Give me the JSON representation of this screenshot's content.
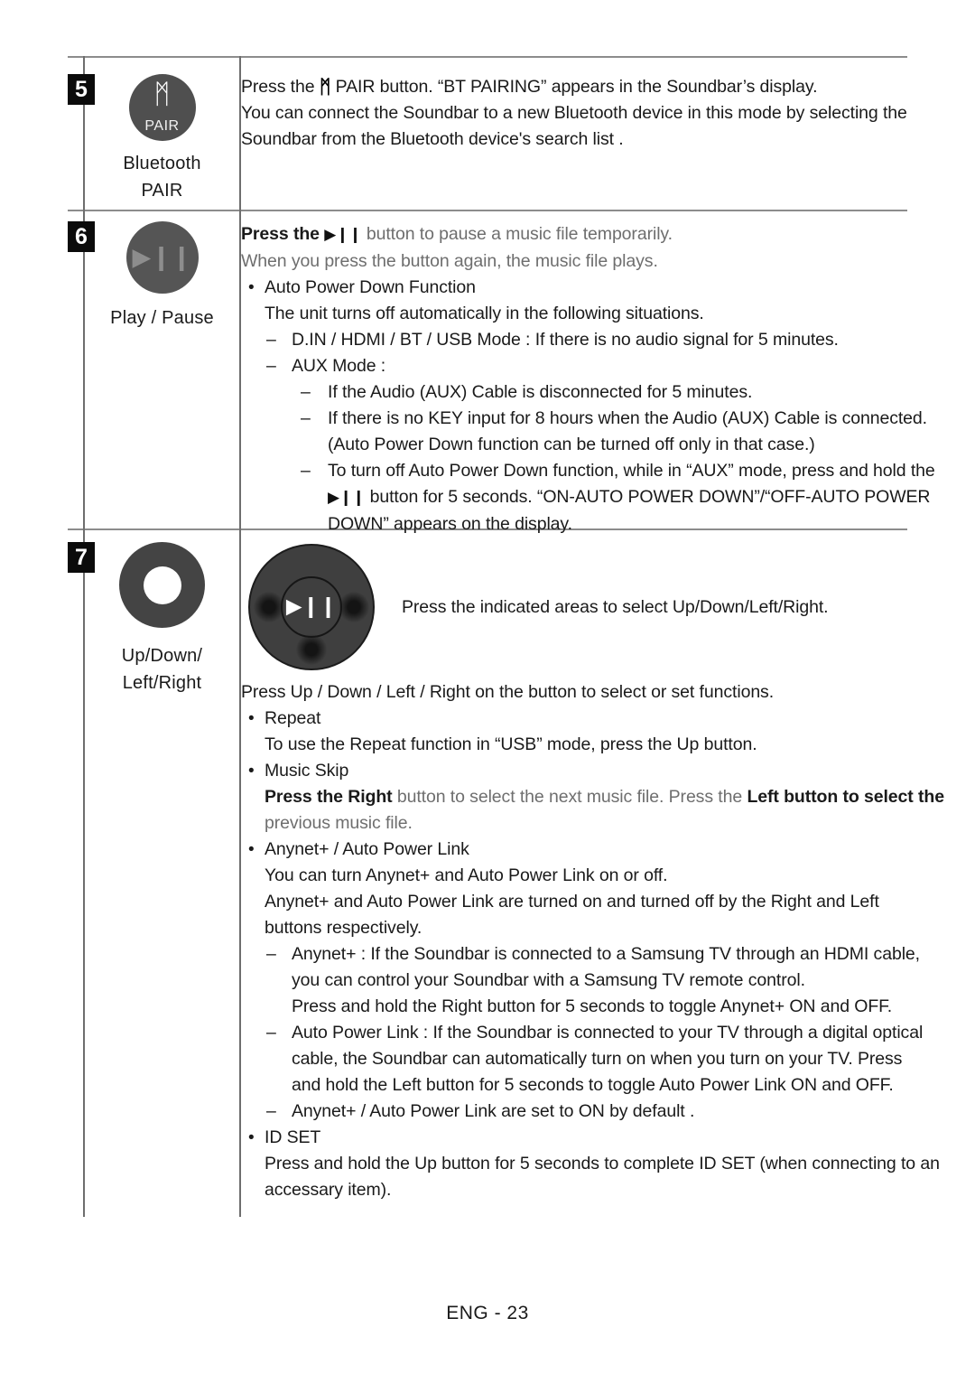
{
  "page": {
    "footer": "ENG - 23"
  },
  "rows": [
    {
      "number": "5",
      "icon": {
        "glyph": "bluetooth-pair",
        "inner_text": "PAIR"
      },
      "label_line1": "Bluetooth",
      "label_line2": "PAIR",
      "lines": [
        {
          "type": "mixed-bt",
          "pre": "Press the",
          "post": "PAIR button. “BT PAIRING” appears in the Soundbar’s display."
        },
        {
          "type": "plain",
          "text": "You can connect the Soundbar to a new Bluetooth device in this mode by selecting the"
        },
        {
          "type": "plain",
          "text": "Soundbar from the Bluetooth device's search list ."
        }
      ]
    },
    {
      "number": "6",
      "icon": {
        "glyph": "play-pause"
      },
      "label_line1": "Play / Pause",
      "label_line2": "",
      "lines": [
        {
          "type": "mixed-play",
          "pre": "Press the",
          "post": "button to pause a music file temporarily."
        },
        {
          "type": "gray",
          "text": "When you press the button again, the music file plays."
        },
        {
          "type": "bullet",
          "text": "Auto Power Down Function"
        },
        {
          "type": "sub",
          "text": "The unit turns off automatically in the following situations."
        },
        {
          "type": "dash",
          "text": "D.IN / HDMI / BT / USB Mode : If there is no audio signal for 5 minutes."
        },
        {
          "type": "dash",
          "text": "AUX Mode :"
        },
        {
          "type": "dash2",
          "text": "If the Audio (AUX) Cable is disconnected for 5 minutes."
        },
        {
          "type": "dash2",
          "text": "If there is no KEY input for 8 hours when the Audio (AUX) Cable is connected."
        },
        {
          "type": "dash2-cont",
          "text": "(Auto Power Down function can be turned off only in that case.)"
        },
        {
          "type": "dash2",
          "text": "To turn off Auto Power Down function, while in “AUX” mode, press and hold the"
        },
        {
          "type": "dash2-cont-play",
          "pre": "",
          "post": "button for 5 seconds. “ON-AUTO POWER DOWN”/“OFF-AUTO POWER"
        },
        {
          "type": "dash2-cont",
          "text": "DOWN” appears on the display."
        }
      ]
    },
    {
      "number": "7",
      "icon": {
        "glyph": "ring-donut"
      },
      "label_line1": "Up/Down/",
      "label_line2": "Left/Right",
      "diagram": {
        "center_glyph": "play-pause",
        "caption": "Press the indicated areas to select Up/Down/Left/Right."
      },
      "lines": [
        {
          "type": "plain",
          "text": "Press Up / Down / Left / Right on the button to select or set functions."
        },
        {
          "type": "bullet",
          "text": "Repeat"
        },
        {
          "type": "sub",
          "text": "To use the Repeat function in “USB” mode, press the Up button."
        },
        {
          "type": "bullet",
          "text": "Music Skip"
        },
        {
          "type": "sub-mixed",
          "seg1": "Press the Right",
          "seg2": " button to select the next music file. Press the ",
          "seg3": "Left button to select",
          "seg4": " the"
        },
        {
          "type": "sub-gray",
          "text": "previous music file."
        },
        {
          "type": "bullet",
          "text": "Anynet+ / Auto Power Link"
        },
        {
          "type": "sub",
          "text": "You can turn Anynet+ and Auto Power Link on or off."
        },
        {
          "type": "sub",
          "text": "Anynet+ and Auto Power Link are turned on and turned off by the Right and Left"
        },
        {
          "type": "sub",
          "text": "buttons respectively."
        },
        {
          "type": "dash",
          "text": "Anynet+ : If the Soundbar is connected to a Samsung TV through an HDMI cable,"
        },
        {
          "type": "dash-cont",
          "text": "you can control your Soundbar with a Samsung TV remote control."
        },
        {
          "type": "dash-cont",
          "text": "Press and hold the Right button for 5 seconds to toggle Anynet+ ON and OFF."
        },
        {
          "type": "dash",
          "text": "Auto Power Link : If the Soundbar is connected to your TV through a digital optical"
        },
        {
          "type": "dash-cont",
          "text": "cable, the Soundbar can automatically turn on when you turn on your TV. Press"
        },
        {
          "type": "dash-cont",
          "text": "and hold the Left button for 5 seconds to toggle Auto Power Link ON and OFF."
        },
        {
          "type": "dash",
          "text": "Anynet+ / Auto Power Link are set to ON by default ."
        },
        {
          "type": "bullet",
          "text": "ID SET"
        },
        {
          "type": "sub",
          "text": "Press and hold the Up button for 5 seconds to complete ID SET (when connecting to an"
        },
        {
          "type": "sub",
          "text": "accessary item)."
        }
      ]
    }
  ],
  "glyphs": {
    "bluetooth": "ᛗ",
    "play_pause": "▶❙❙",
    "bullet": "•",
    "dash": "–"
  }
}
